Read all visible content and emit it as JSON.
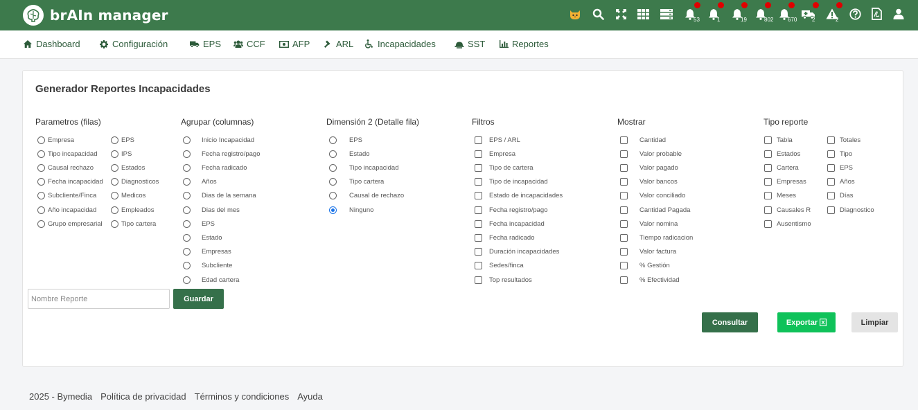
{
  "app": {
    "title": "brAIn manager"
  },
  "topbar": {
    "icons": [
      {
        "name": "cat-avatar-icon"
      },
      {
        "name": "search-icon"
      },
      {
        "name": "fullscreen-icon"
      },
      {
        "name": "grid-apps-icon"
      },
      {
        "name": "server-icon"
      },
      {
        "name": "bell-icon",
        "count": "53"
      },
      {
        "name": "bell-icon",
        "count": "1"
      },
      {
        "name": "bell-icon",
        "count": "19"
      },
      {
        "name": "bell-icon",
        "count": "802"
      },
      {
        "name": "bell-icon",
        "count": "670"
      },
      {
        "name": "ambulance-icon",
        "count": "2"
      },
      {
        "name": "warning-icon",
        "count": "2"
      },
      {
        "name": "help-icon"
      },
      {
        "name": "pdf-file-icon"
      },
      {
        "name": "user-icon"
      }
    ],
    "badge_color": "#e00000"
  },
  "nav": {
    "items": [
      {
        "label": "Dashboard",
        "icon": "home-icon"
      },
      {
        "label": "Configuración",
        "icon": "gear-icon"
      },
      {
        "label": "EPS",
        "icon": "ambulance-icon"
      },
      {
        "label": "CCF",
        "icon": "users-icon"
      },
      {
        "label": "AFP",
        "icon": "money-icon"
      },
      {
        "label": "ARL",
        "icon": "gavel-icon"
      },
      {
        "label": "Incapacidades",
        "icon": "wheelchair-icon"
      },
      {
        "label": "SST",
        "icon": "hard-hat-icon"
      },
      {
        "label": "Reportes",
        "icon": "bar-chart-icon"
      }
    ]
  },
  "card": {
    "title": "Generador Reportes Incapacidades",
    "columns": [
      {
        "title": "Parametros (filas)",
        "type": "radio",
        "options": [
          [
            "Empresa",
            "Tipo incapacidad",
            "Causal rechazo",
            "Fecha incapacidad",
            "Subcliente/Finca",
            "Año incapacidad",
            "Grupo empresarial"
          ],
          [
            "EPS",
            "IPS",
            "Estados",
            "Diagnosticos",
            "Medicos",
            "Empleados",
            "Tipo cartera"
          ]
        ]
      },
      {
        "title": "Agrupar (columnas)",
        "type": "radio",
        "options": [
          [
            "Inicio Incapacidad",
            "Fecha registro/pago",
            "Fecha radicado",
            "Años",
            "Dias de la semana",
            "Dias del mes",
            "EPS",
            "Estado",
            "Empresas",
            "Subcliente",
            "Edad cartera"
          ]
        ]
      },
      {
        "title": "Dimensión 2 (Detalle fila)",
        "type": "radio",
        "selected": "Ninguno",
        "options": [
          [
            "EPS",
            "Estado",
            "Tipo incapacidad",
            "Tipo cartera",
            "Causal de rechazo",
            "Ninguno"
          ]
        ]
      },
      {
        "title": "Filtros",
        "type": "checkbox",
        "options": [
          [
            "EPS / ARL",
            "Empresa",
            "Tipo de cartera",
            "Tipo de incapacidad",
            "Estado de incapacidades",
            "Fecha registro/pago",
            "Fecha incapacidad",
            "Fecha radicado",
            "Duración incapacidades",
            "Sedes/finca",
            "Top resultados"
          ]
        ]
      },
      {
        "title": "Mostrar",
        "type": "checkbox",
        "options": [
          [
            "Cantidad",
            "Valor probable",
            "Valor pagado",
            "Valor bancos",
            "Valor conciliado",
            "Cantidad Pagada",
            "Valor nomina",
            "Tiempo radicacion",
            "Valor factura",
            "% Gestión",
            "% Efectividad"
          ]
        ]
      },
      {
        "title": "Tipo reporte",
        "type": "checkbox",
        "options": [
          [
            "Tabla",
            "Estados",
            "Cartera",
            "Empresas",
            "Meses",
            "Causales R",
            "Ausentismo"
          ],
          [
            "Totales",
            "Tipo",
            "EPS",
            "Años",
            "Días",
            "Diagnostico"
          ]
        ]
      }
    ],
    "report_name": {
      "value": "",
      "placeholder": "Nombre Reporte"
    },
    "buttons": {
      "save": "Guardar",
      "query": "Consultar",
      "export": "Exportar",
      "clear": "Limpiar"
    }
  },
  "footer": {
    "copyright": "2025 - Bymedia",
    "privacy": "Política de privacidad",
    "terms": "Términos y condiciones",
    "help": "Ayuda"
  },
  "colors": {
    "brand_green": "#3d7a4c",
    "button_green": "#35704a",
    "export_green": "#0fc25a",
    "radio_selected": "#1a73e8"
  }
}
